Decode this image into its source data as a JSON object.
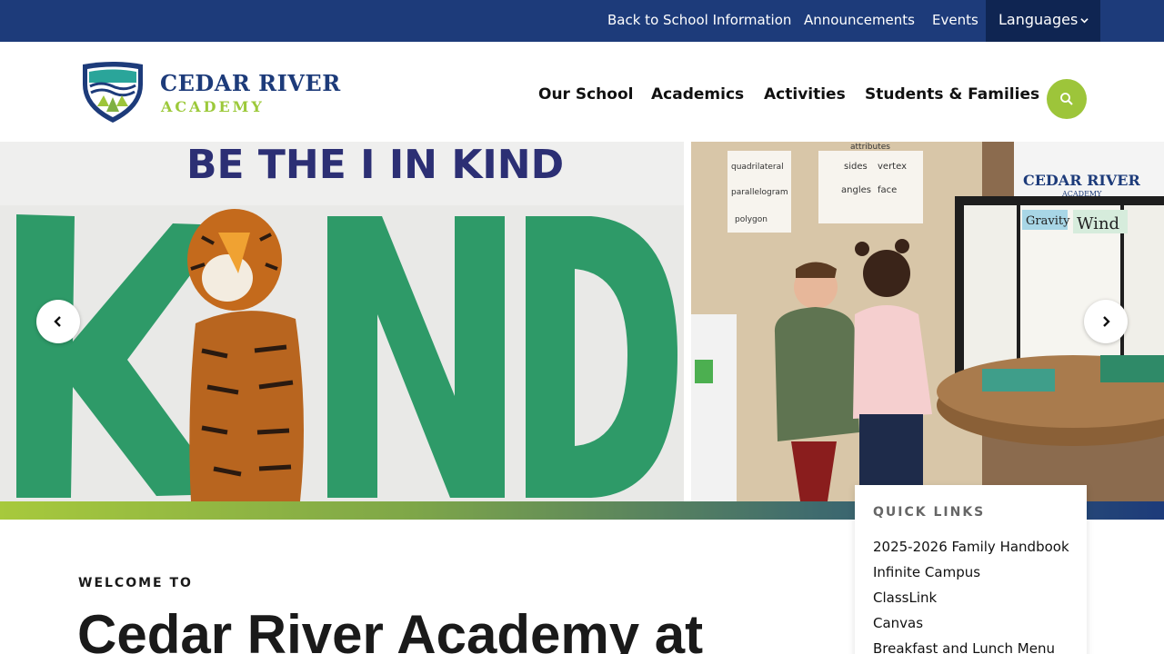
{
  "topbar": {
    "links": [
      "Back to School Information",
      "Announcements",
      "Events"
    ],
    "languages_label": "Languages"
  },
  "brand": {
    "name": "CEDAR RIVER",
    "sub": "ACADEMY"
  },
  "nav": {
    "items": [
      "Our School",
      "Academics",
      "Activities",
      "Students & Families"
    ]
  },
  "hero": {
    "left_banner_text": "BE THE I IN KIND",
    "left_big_text": "KIND",
    "right_poster_brand": "CEDAR RIVER",
    "right_poster_sub": "ACADEMY",
    "right_poster_words": [
      "Gravity",
      "Wind"
    ],
    "right_wall_chart": [
      "attributes",
      "quadrilateral",
      "sides",
      "vertex",
      "parallelogram",
      "angles",
      "face",
      "polygon"
    ]
  },
  "quick_links": {
    "title": "QUICK LINKS",
    "items": [
      "2025-2026 Family Handbook",
      "Infinite Campus",
      "ClassLink",
      "Canvas",
      "Breakfast and Lunch Menu"
    ]
  },
  "welcome": {
    "eyebrow": "WELCOME TO",
    "title": "Cedar River Academy at"
  },
  "colors": {
    "navy": "#1d3b7a",
    "lime": "#9dc53a",
    "green_letters": "#2e9a68"
  }
}
